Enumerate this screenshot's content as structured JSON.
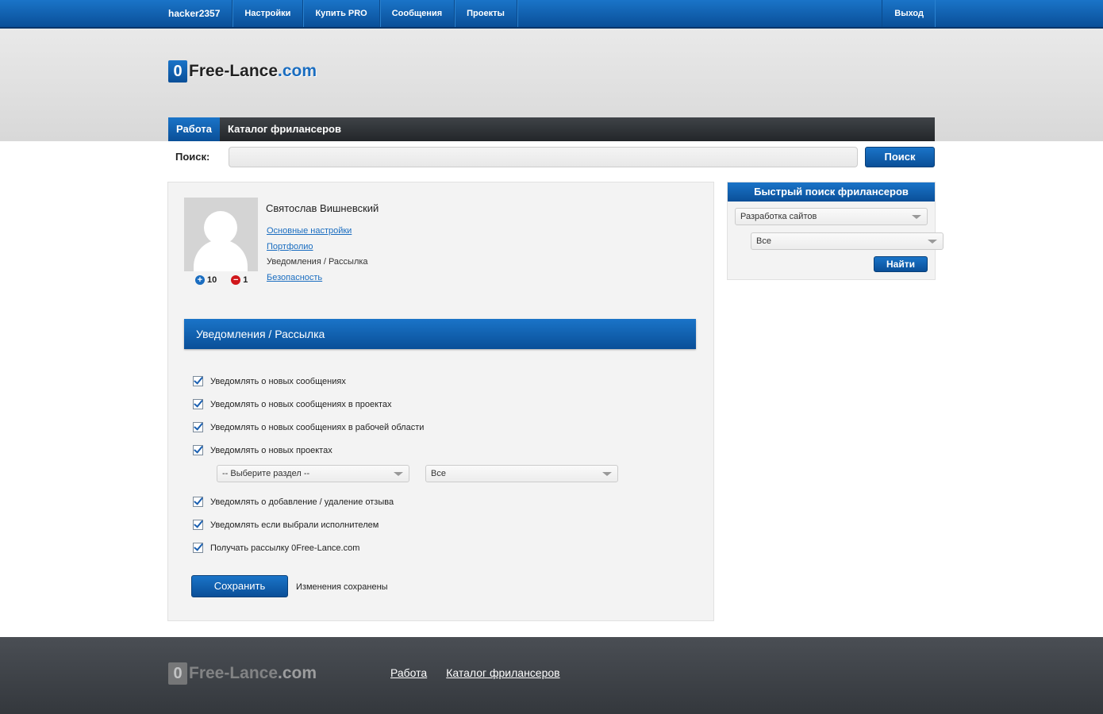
{
  "topnav": {
    "username": "hacker2357",
    "items": [
      "Настройки",
      "Купить PRO",
      "Сообщения",
      "Проекты"
    ],
    "logout": "Выход"
  },
  "logo": {
    "zero": "0",
    "name": "Free-Lance",
    "domain": ".com"
  },
  "tabs": {
    "work": "Работа",
    "catalog": "Каталог фрилансеров"
  },
  "search": {
    "label": "Поиск:",
    "placeholder": "",
    "button": "Поиск"
  },
  "profile": {
    "name": "Святослав Вишневский",
    "rating_plus": "10",
    "rating_minus": "1",
    "menu": {
      "basic": "Основные настройки",
      "portfolio": "Портфолио",
      "notifications": "Уведомления / Рассылка",
      "security": "Безопасность"
    }
  },
  "section": {
    "title": "Уведомления / Рассылка",
    "checks": [
      "Уведомлять о новых сообщениях",
      "Уведомлять о новых сообщениях в проектах",
      "Уведомлять о новых сообщениях в рабочей области",
      "Уведомлять о новых проектах"
    ],
    "select_section": "-- Выберите раздел --",
    "select_sub": "Все",
    "checks2": [
      "Уведомлять о добавление / удаление отзыва",
      "Уведомлять если выбрали исполнителем",
      "Получать рассылку 0Free-Lance.com"
    ],
    "save": "Сохранить",
    "saved_msg": "Изменения сохранены"
  },
  "sidebar": {
    "title": "Быстрый поиск фрилансеров",
    "category": "Разработка сайтов",
    "subcategory": "Все",
    "find": "Найти"
  },
  "footer": {
    "logo_zero": "0",
    "logo_name": "Free-Lance",
    "logo_domain": ".com",
    "links": [
      "Работа",
      "Каталог фрилансеров"
    ]
  },
  "colors": {
    "primary": "#0a4f98",
    "accent": "#1a74c8",
    "link": "#1a6dc0",
    "footer": "#3d4146"
  }
}
